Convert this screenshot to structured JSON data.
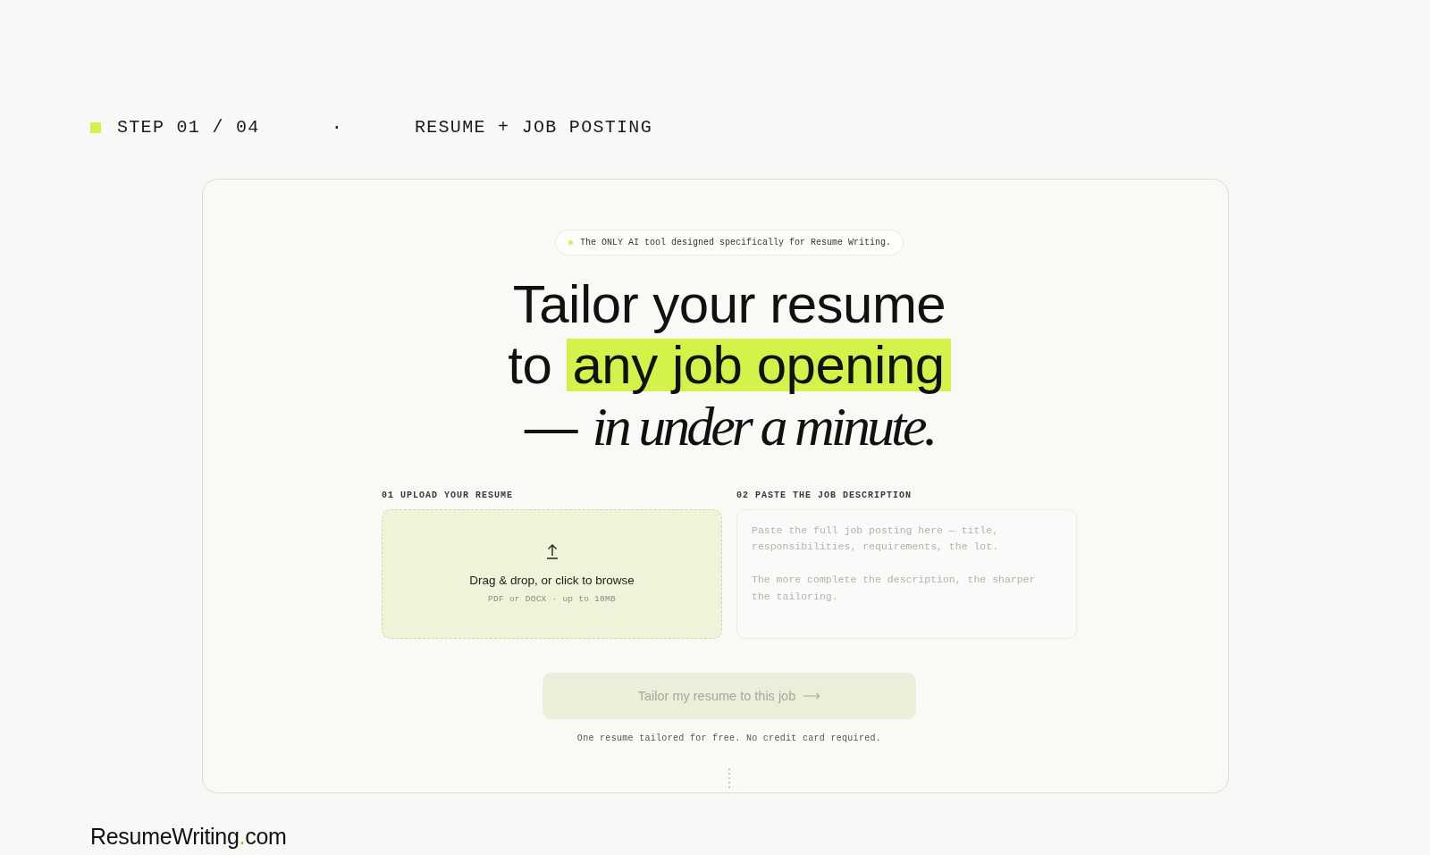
{
  "progress": {
    "step": "STEP 01 / 04",
    "separator": "·",
    "title": "RESUME + JOB POSTING"
  },
  "card": {
    "badge": {
      "text": "The ONLY AI tool designed specifically for Resume Writing."
    },
    "headline": {
      "lines": [
        [
          {
            "text": "Tailor your resume",
            "kind": "plain"
          }
        ],
        [
          {
            "text": "to",
            "kind": "plain"
          },
          {
            "text": "any job opening",
            "kind": "highlight"
          }
        ],
        [
          {
            "text": "—",
            "kind": "plain"
          },
          {
            "text": "in under a minute.",
            "kind": "italic"
          }
        ]
      ]
    },
    "upload": {
      "label": "01 UPLOAD YOUR RESUME",
      "prompt": "Drag & drop, or click to browse",
      "hint": "PDF or DOCX · up to 10MB"
    },
    "job_description": {
      "label": "02 PASTE THE JOB DESCRIPTION",
      "placeholder": "Paste the full job posting here — title, responsibilities, requirements, the lot.\n\nThe more complete the description, the sharper the tailoring."
    },
    "submit_button": {
      "label": "Tailor my resume to this job",
      "disabled": true
    },
    "note": "One resume tailored for free. No credit card required."
  },
  "brand": {
    "parts": [
      {
        "text": "ResumeWriting",
        "accent": false
      },
      {
        "text": ".",
        "accent": true
      },
      {
        "text": "com",
        "accent": false
      }
    ]
  }
}
